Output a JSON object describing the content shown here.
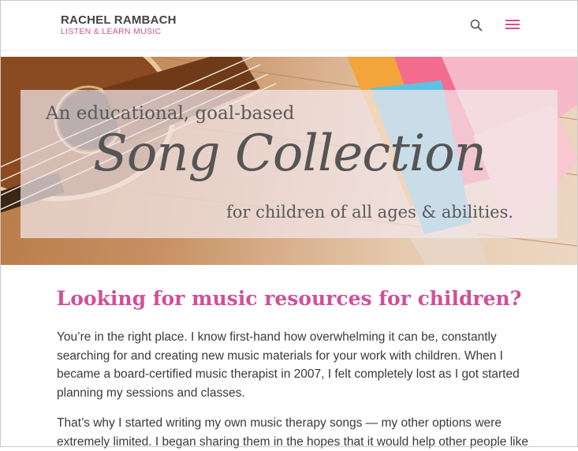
{
  "header": {
    "logo_name": "RACHEL RAMBACH",
    "logo_tagline": "LISTEN & LEARN MUSIC",
    "brand_color": "#d14f98"
  },
  "icons": {
    "search": "search-icon",
    "menu": "hamburger-menu-icon"
  },
  "hero": {
    "line1": "An educational, goal-based",
    "line2": "Song Collection",
    "line3": "for children of all ages & abilities."
  },
  "content": {
    "headline": "Looking for music resources for children?",
    "para1": "You’re in the right place. I know first-hand how overwhelming it can be, constantly searching for and creating new music materials for your work with children. When I became a board-certified music therapist in 2007, I felt completely lost as I got started planning my sessions and classes.",
    "para2": "That’s why I started writing my own music therapy songs — my other options were extremely limited. I began sharing them in the hopes that it would help other people like"
  }
}
